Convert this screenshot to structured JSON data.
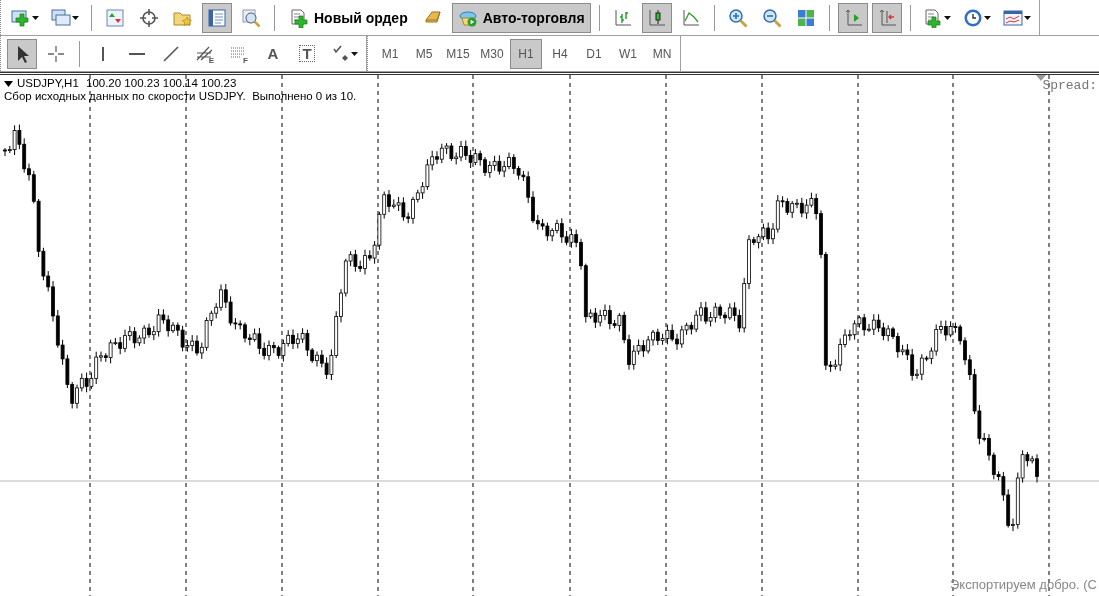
{
  "toolbar_main": [
    {
      "kind": "icon",
      "pressed": false,
      "menu": true
    },
    {
      "kind": "icon",
      "pressed": false,
      "menu": true
    },
    {
      "kind": "separator"
    },
    {
      "kind": "icon",
      "pressed": false,
      "menu": false
    },
    {
      "kind": "icon",
      "pressed": false,
      "menu": false
    },
    {
      "kind": "icon",
      "pressed": false,
      "menu": false
    },
    {
      "kind": "icon",
      "pressed": true,
      "menu": false
    },
    {
      "kind": "icon",
      "pressed": false,
      "menu": false
    },
    {
      "kind": "separator"
    },
    {
      "kind": "button",
      "label": "Новый ордер",
      "pressed": false
    },
    {
      "kind": "icon",
      "pressed": false,
      "menu": false
    },
    {
      "kind": "button",
      "label": "Авто-торговля",
      "pressed": true
    },
    {
      "kind": "separator"
    },
    {
      "kind": "icon",
      "pressed": false,
      "menu": false
    },
    {
      "kind": "icon",
      "pressed": true,
      "menu": false
    },
    {
      "kind": "icon",
      "pressed": false,
      "menu": false
    },
    {
      "kind": "separator"
    },
    {
      "kind": "icon",
      "pressed": false,
      "menu": false
    },
    {
      "kind": "icon",
      "pressed": false,
      "menu": false
    },
    {
      "kind": "icon",
      "pressed": false,
      "menu": false
    },
    {
      "kind": "separator"
    },
    {
      "kind": "icon",
      "pressed": true,
      "menu": false
    },
    {
      "kind": "icon",
      "pressed": true,
      "menu": false
    },
    {
      "kind": "separator"
    },
    {
      "kind": "icon",
      "pressed": false,
      "menu": true
    },
    {
      "kind": "icon",
      "pressed": false,
      "menu": true
    },
    {
      "kind": "icon",
      "pressed": false,
      "menu": true
    }
  ],
  "toolbar_draw": [
    {
      "kind": "icon",
      "pressed": true,
      "menu": false
    },
    {
      "kind": "icon",
      "pressed": false,
      "menu": false
    },
    {
      "kind": "separator"
    },
    {
      "kind": "icon",
      "pressed": false,
      "menu": false
    },
    {
      "kind": "icon",
      "pressed": false,
      "menu": false
    },
    {
      "kind": "icon",
      "pressed": false,
      "menu": false
    },
    {
      "kind": "icon",
      "pressed": false,
      "menu": false,
      "glyph": "E"
    },
    {
      "kind": "icon",
      "pressed": false,
      "menu": false,
      "glyph": "F"
    },
    {
      "kind": "icon",
      "pressed": false,
      "menu": false,
      "glyph": "A"
    },
    {
      "kind": "icon",
      "pressed": false,
      "menu": false,
      "glyph": "T"
    },
    {
      "kind": "icon",
      "pressed": false,
      "menu": true
    }
  ],
  "timeframes": [
    {
      "label": "M1",
      "selected": false
    },
    {
      "label": "M5",
      "selected": false
    },
    {
      "label": "M15",
      "selected": false
    },
    {
      "label": "M30",
      "selected": false
    },
    {
      "label": "H1",
      "selected": true
    },
    {
      "label": "H4",
      "selected": false
    },
    {
      "label": "D1",
      "selected": false
    },
    {
      "label": "W1",
      "selected": false
    },
    {
      "label": "MN",
      "selected": false
    }
  ],
  "chart": {
    "symbol": "USDJPY,H1",
    "quotes": "100.20 100.23 100.14 100.23",
    "status": "Сбор исходных данных по скорости USDJPY.  Выполнено 0 из 10.",
    "spread": "Spread:",
    "comment": "Экспортируем добро. (С"
  }
}
